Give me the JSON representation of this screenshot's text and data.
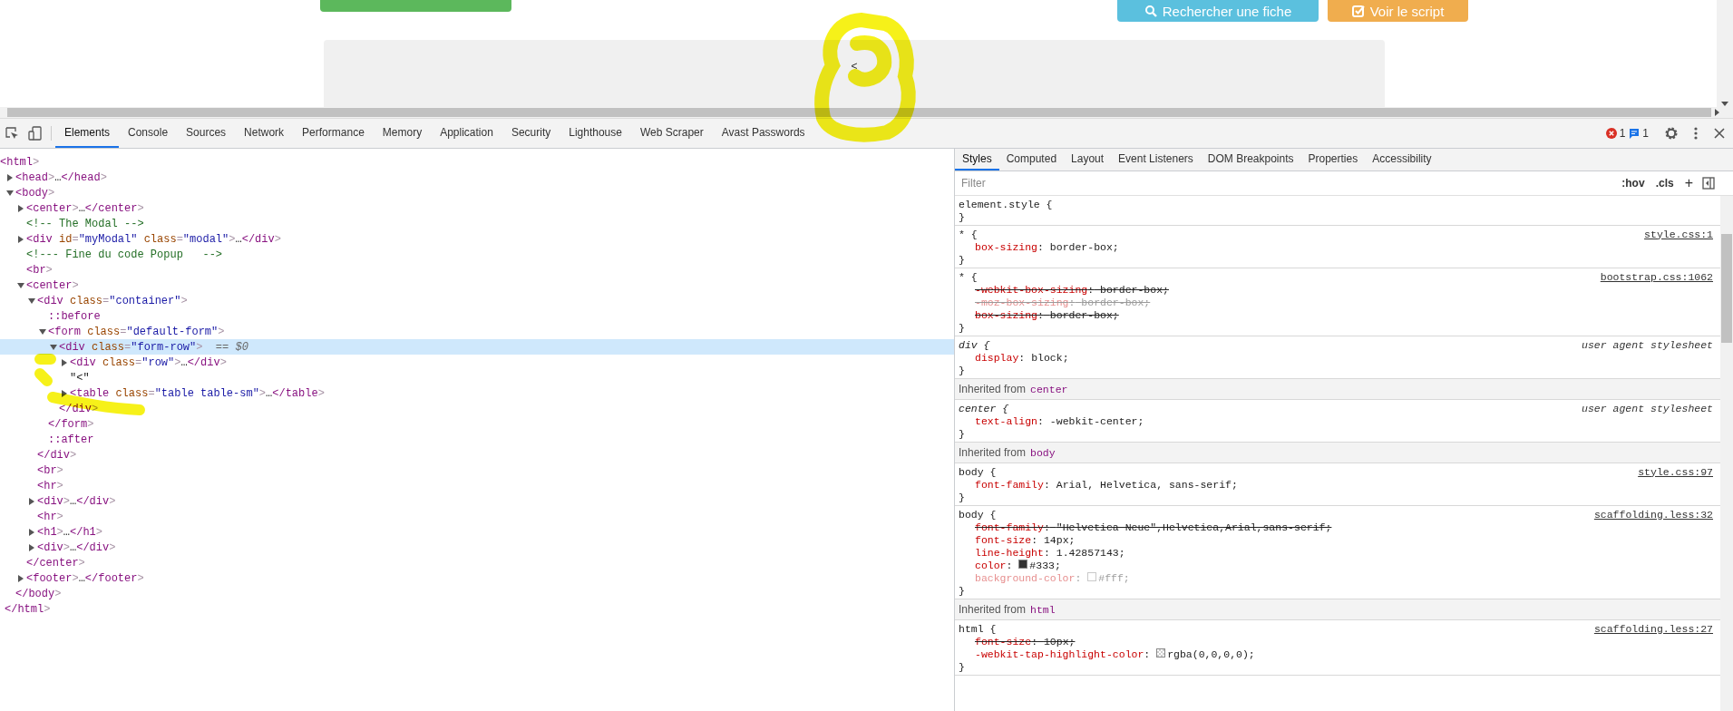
{
  "page": {
    "buttons": [
      {
        "kind": "success"
      },
      {
        "kind": "info",
        "label": "Rechercher une fiche"
      },
      {
        "kind": "warning",
        "label": "Voir le script"
      }
    ],
    "panel_text": "<"
  },
  "devtools": {
    "tabs": [
      {
        "label": "Elements",
        "selected": true
      },
      {
        "label": "Console",
        "selected": false
      },
      {
        "label": "Sources",
        "selected": false
      },
      {
        "label": "Network",
        "selected": false
      },
      {
        "label": "Performance",
        "selected": false
      },
      {
        "label": "Memory",
        "selected": false
      },
      {
        "label": "Application",
        "selected": false
      },
      {
        "label": "Security",
        "selected": false
      },
      {
        "label": "Lighthouse",
        "selected": false
      },
      {
        "label": "Web Scraper",
        "selected": false
      },
      {
        "label": "Avast Passwords",
        "selected": false
      }
    ],
    "error_count": "1",
    "message_count": "1"
  },
  "tree": [
    {
      "kind": "root",
      "text": "<html>",
      "selected": false,
      "close": "</html>",
      "children": [
        {
          "kind": "element",
          "text": "<head>…</head>",
          "expanded": false,
          "selected": false
        },
        {
          "kind": "element",
          "text": "<body>",
          "expanded": true,
          "selected": false,
          "close": "</body>",
          "children": [
            {
              "kind": "element",
              "text": "<center>…</center>",
              "expanded": false,
              "selected": false
            },
            {
              "kind": "comment",
              "text": "<!-- The Modal -->",
              "selected": false
            },
            {
              "kind": "element",
              "text": "<div id=\"myModal\" class=\"modal\">…</div>",
              "expanded": false,
              "selected": false
            },
            {
              "kind": "comment",
              "text": "<!--- Fine du code Popup   -->",
              "selected": false
            },
            {
              "kind": "void",
              "text": "<br>",
              "selected": false
            },
            {
              "kind": "element",
              "text": "<center>",
              "expanded": true,
              "selected": false,
              "close": "</center>",
              "children": [
                {
                  "kind": "element",
                  "text": "<div class=\"container\">",
                  "expanded": true,
                  "selected": false,
                  "close": "</div>",
                  "children": [
                    {
                      "kind": "pseudo",
                      "text": "::before",
                      "selected": false
                    },
                    {
                      "kind": "element",
                      "text": "<form class=\"default-form\">",
                      "expanded": true,
                      "selected": false,
                      "close": "</form>",
                      "children": [
                        {
                          "kind": "element",
                          "text": "<div class=\"form-row\">",
                          "suffix": "== $0",
                          "expanded": true,
                          "selected": true,
                          "close": "</div>",
                          "children": [
                            {
                              "kind": "element",
                              "text": "<div class=\"row\">…</div>",
                              "expanded": false,
                              "selected": false
                            },
                            {
                              "kind": "text",
                              "text": "\"<\"",
                              "selected": false
                            },
                            {
                              "kind": "element",
                              "text": "<table class=\"table table-sm\">…</table>",
                              "expanded": false,
                              "selected": false
                            }
                          ]
                        }
                      ]
                    },
                    {
                      "kind": "pseudo",
                      "text": "::after",
                      "selected": false
                    }
                  ]
                },
                {
                  "kind": "void",
                  "text": "<br>",
                  "selected": false
                },
                {
                  "kind": "void",
                  "text": "<hr>",
                  "selected": false
                },
                {
                  "kind": "element",
                  "text": "<div>…</div>",
                  "expanded": false,
                  "selected": false
                },
                {
                  "kind": "void",
                  "text": "<hr>",
                  "selected": false
                },
                {
                  "kind": "element",
                  "text": "<h1>…</h1>",
                  "expanded": false,
                  "selected": false
                },
                {
                  "kind": "element",
                  "text": "<div>…</div>",
                  "expanded": false,
                  "selected": false
                }
              ]
            },
            {
              "kind": "element",
              "text": "<footer>…</footer>",
              "expanded": false,
              "selected": false
            }
          ]
        }
      ]
    }
  ],
  "styles": {
    "tabs": [
      {
        "label": "Styles",
        "selected": true
      },
      {
        "label": "Computed",
        "selected": false
      },
      {
        "label": "Layout",
        "selected": false
      },
      {
        "label": "Event Listeners",
        "selected": false
      },
      {
        "label": "DOM Breakpoints",
        "selected": false
      },
      {
        "label": "Properties",
        "selected": false
      },
      {
        "label": "Accessibility",
        "selected": false
      }
    ],
    "filter": {
      "placeholder": "Filter"
    },
    "hov": ":hov",
    "cls": ".cls",
    "add": "+",
    "sections": [
      {
        "kind": "rule",
        "open": "element.style {",
        "close": "}",
        "user_agent": false
      },
      {
        "kind": "rule",
        "open": "* {",
        "source": "style.css:1",
        "close": "}",
        "user_agent": false,
        "declarations": [
          {
            "property": "box-sizing:",
            "value": "border-box;",
            "struck": false,
            "inactive": false
          }
        ]
      },
      {
        "kind": "rule",
        "open": "* {",
        "source": "bootstrap.css:1062",
        "close": "}",
        "user_agent": false,
        "declarations": [
          {
            "property": "-webkit-box-sizing:",
            "value": "border-box;",
            "struck": true,
            "inactive": false
          },
          {
            "property": "-moz-box-sizing:",
            "value": "border-box;",
            "struck": true,
            "inactive": true
          },
          {
            "property": "box-sizing:",
            "value": "border-box;",
            "struck": true,
            "inactive": false
          }
        ]
      },
      {
        "kind": "rule",
        "open": "div {",
        "source": "user agent stylesheet",
        "close": "}",
        "user_agent": true,
        "declarations": [
          {
            "property": "display:",
            "value": "block;",
            "struck": false,
            "inactive": false
          }
        ]
      },
      {
        "kind": "inherited",
        "label": "Inherited from",
        "element": "center"
      },
      {
        "kind": "rule",
        "open": "center {",
        "source": "user agent stylesheet",
        "close": "}",
        "user_agent": true,
        "declarations": [
          {
            "property": "text-align:",
            "value": "-webkit-center;",
            "struck": false,
            "inactive": false
          }
        ]
      },
      {
        "kind": "inherited",
        "label": "Inherited from",
        "element": "body"
      },
      {
        "kind": "rule",
        "open": "body {",
        "source": "style.css:97",
        "close": "}",
        "user_agent": false,
        "declarations": [
          {
            "property": "font-family:",
            "value": "Arial, Helvetica, sans-serif;",
            "struck": false,
            "inactive": false
          }
        ]
      },
      {
        "kind": "rule",
        "open": "body {",
        "source": "scaffolding.less:32",
        "close": "}",
        "user_agent": false,
        "declarations": [
          {
            "property": "font-family:",
            "value": "\"Helvetica Neue\",Helvetica,Arial,sans-serif;",
            "struck": true,
            "inactive": false
          },
          {
            "property": "font-size:",
            "value": "14px;",
            "struck": false,
            "inactive": false
          },
          {
            "property": "line-height:",
            "value": "1.42857143;",
            "struck": false,
            "inactive": false
          },
          {
            "property": "color:",
            "value": "#333;",
            "struck": false,
            "inactive": false,
            "swatch": {
              "kind": "solid",
              "color": "#333333"
            }
          },
          {
            "property": "background-color:",
            "value": "#fff;",
            "struck": false,
            "inactive": true,
            "swatch": {
              "kind": "solid",
              "color": "#ffffff"
            }
          }
        ]
      },
      {
        "kind": "inherited",
        "label": "Inherited from",
        "element": "html"
      },
      {
        "kind": "rule",
        "open": "html {",
        "source": "scaffolding.less:27",
        "close": "}",
        "user_agent": false,
        "declarations": [
          {
            "property": "font-size:",
            "value": "10px;",
            "struck": true,
            "inactive": false
          },
          {
            "property": "-webkit-tap-highlight-color:",
            "value": "rgba(0,0,0,0);",
            "struck": false,
            "inactive": false,
            "swatch": {
              "kind": "checker"
            }
          }
        ]
      }
    ]
  }
}
